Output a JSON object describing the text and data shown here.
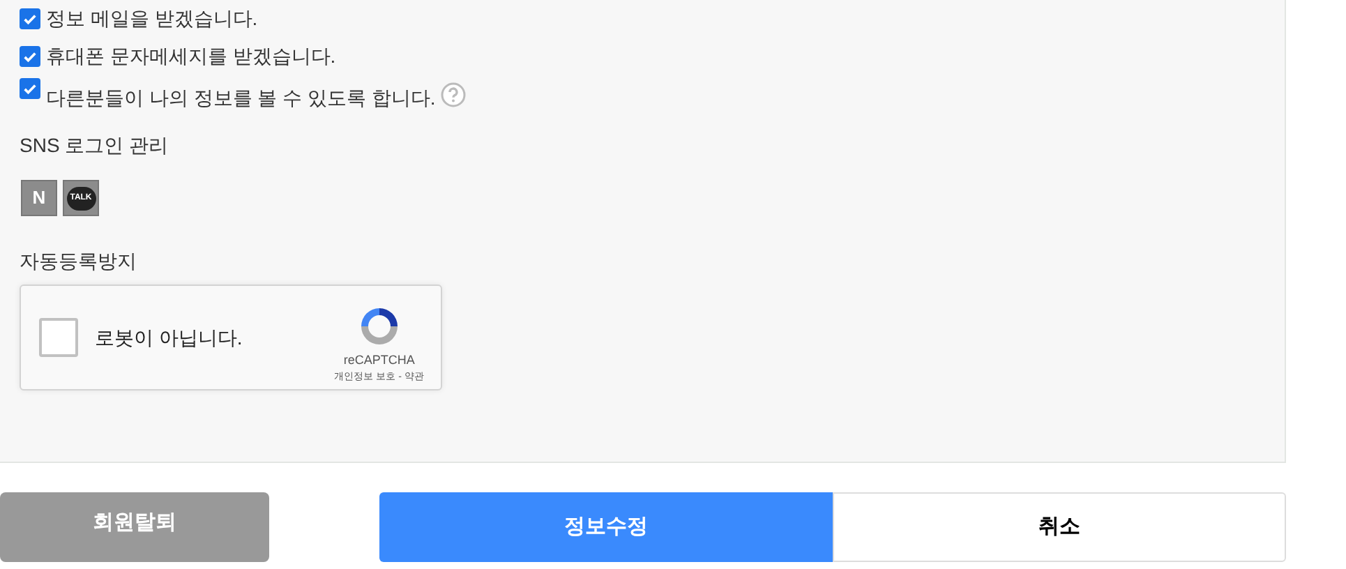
{
  "consents": [
    {
      "label": "정보 메일을 받겠습니다.",
      "checked": true,
      "help": false
    },
    {
      "label": "휴대폰 문자메세지를 받겠습니다.",
      "checked": true,
      "help": false
    },
    {
      "label": "다른분들이 나의 정보를 볼 수 있도록 합니다.",
      "checked": true,
      "help": true
    }
  ],
  "sns": {
    "title": "SNS 로그인 관리",
    "icons": [
      {
        "kind": "naver",
        "text": "N"
      },
      {
        "kind": "kakao",
        "text": "TALK"
      }
    ]
  },
  "captcha": {
    "title": "자동등록방지",
    "label": "로봇이 아닙니다.",
    "checked": false,
    "brand": "reCAPTCHA",
    "privacy": "개인정보 보호",
    "separator": "-",
    "terms": "약관"
  },
  "buttons": [
    {
      "label": "회원탈퇴",
      "kind": "gray"
    },
    {
      "label": "정보수정",
      "kind": "primary"
    },
    {
      "label": "취소",
      "kind": "outline"
    }
  ]
}
